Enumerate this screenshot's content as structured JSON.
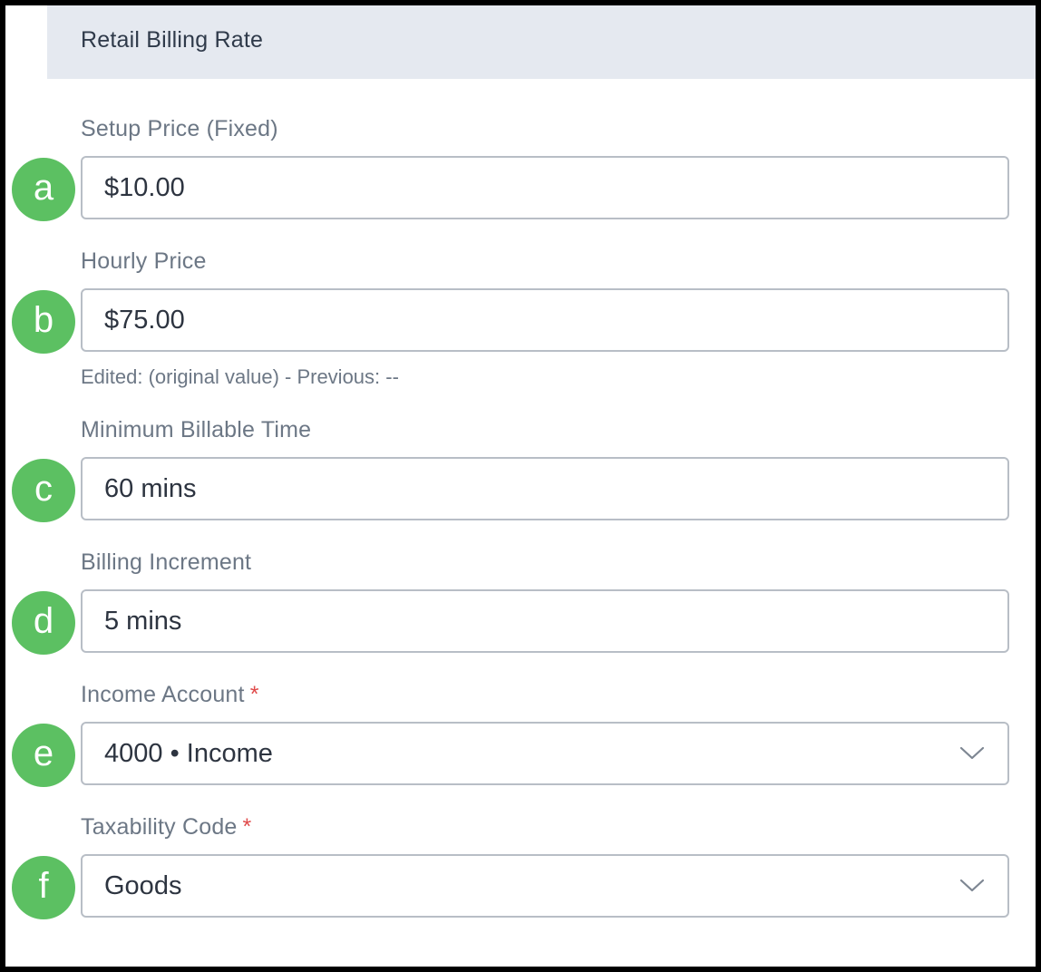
{
  "section": {
    "title": "Retail Billing Rate"
  },
  "required_marker": "*",
  "colors": {
    "badge": "#5cc062",
    "header_bg": "#e5e9f0",
    "required": "#e04b4b"
  },
  "fields": [
    {
      "badge": "a",
      "label": "Setup Price (Fixed)",
      "value": "$10.00"
    },
    {
      "badge": "b",
      "label": "Hourly Price",
      "value": "$75.00",
      "helper": "Edited: (original value) - Previous: --"
    },
    {
      "badge": "c",
      "label": "Minimum Billable Time",
      "value": "60 mins"
    },
    {
      "badge": "d",
      "label": "Billing Increment",
      "value": "5 mins"
    },
    {
      "badge": "e",
      "label": "Income Account",
      "value": "4000 • Income",
      "icon": "chevron-down-icon"
    },
    {
      "badge": "f",
      "label": "Taxability Code",
      "value": "Goods",
      "icon": "chevron-down-icon"
    }
  ]
}
